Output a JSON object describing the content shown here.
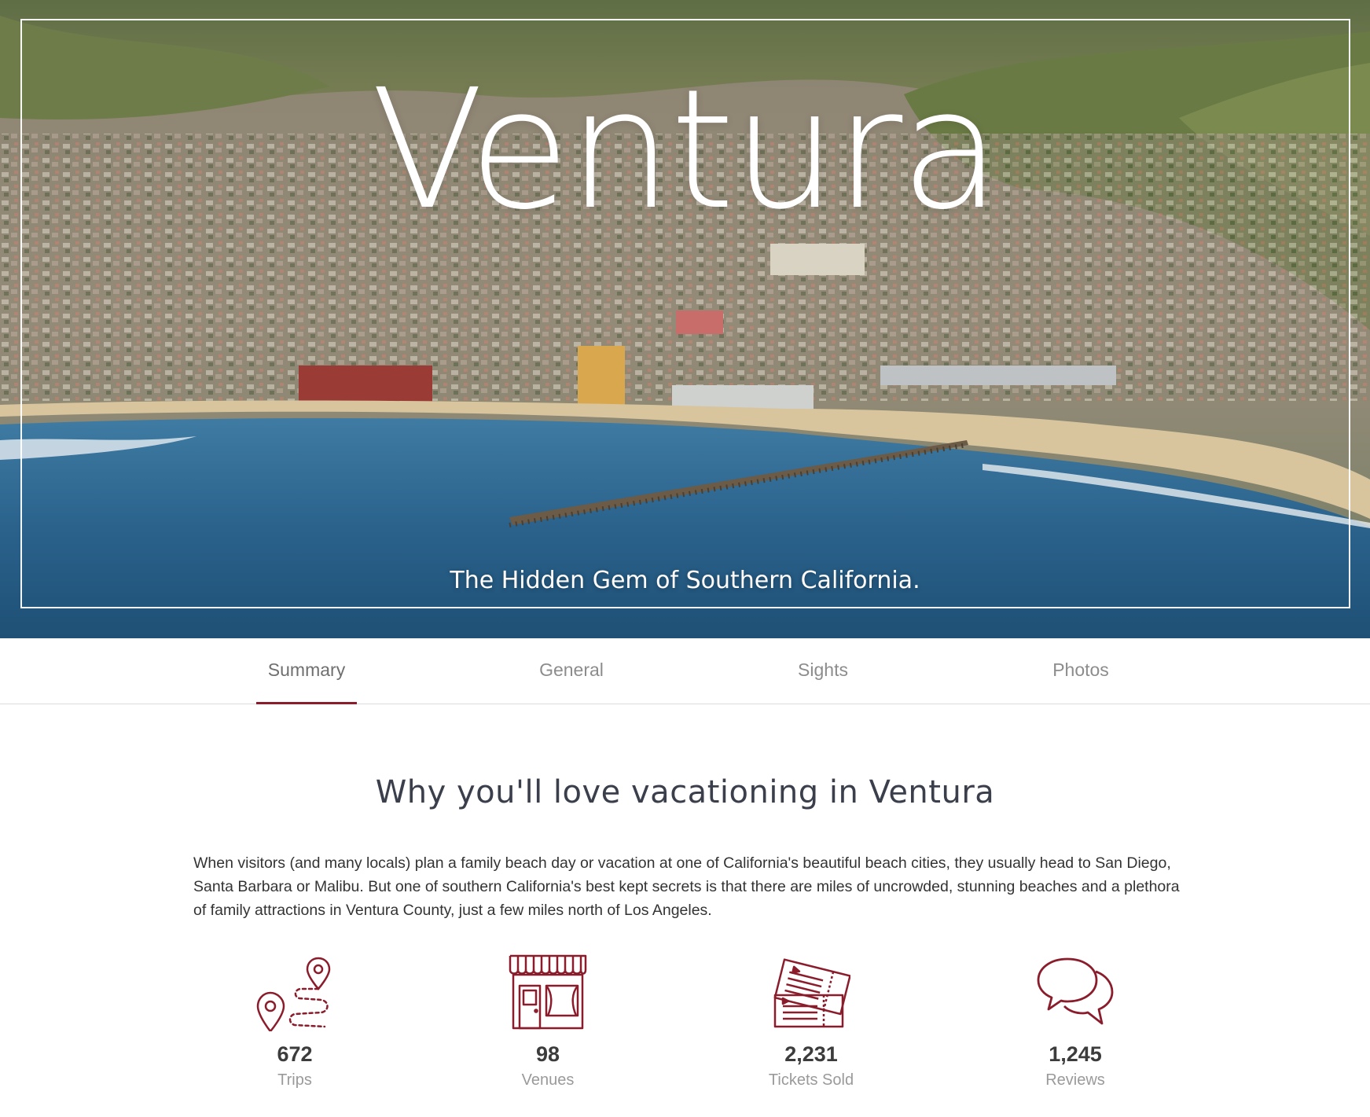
{
  "hero": {
    "title": "Ventura",
    "subtitle": "The Hidden Gem of Southern California."
  },
  "tabs": [
    {
      "label": "Summary",
      "active": true
    },
    {
      "label": "General",
      "active": false
    },
    {
      "label": "Sights",
      "active": false
    },
    {
      "label": "Photos",
      "active": false
    }
  ],
  "main": {
    "heading": "Why you'll love vacationing in Ventura",
    "intro": "When visitors (and many locals) plan a family beach day or vacation at one of California's beautiful beach cities, they usually head to San Diego, Santa Barbara or Malibu. But one of southern California's best kept secrets is that there are miles of uncrowded, stunning beaches and a plethora of family attractions in Ventura County, just a few miles north of Los Angeles."
  },
  "stats": [
    {
      "icon": "map-route-icon",
      "value": "672",
      "label": "Trips"
    },
    {
      "icon": "storefront-icon",
      "value": "98",
      "label": "Venues"
    },
    {
      "icon": "tickets-icon",
      "value": "2,231",
      "label": "Tickets Sold"
    },
    {
      "icon": "speech-bubbles-icon",
      "value": "1,245",
      "label": "Reviews"
    }
  ],
  "colors": {
    "accent": "#8a1c2b",
    "heading": "#3a3f4b",
    "tab_text": "#8c8c8c",
    "label_text": "#9a9a9a"
  }
}
